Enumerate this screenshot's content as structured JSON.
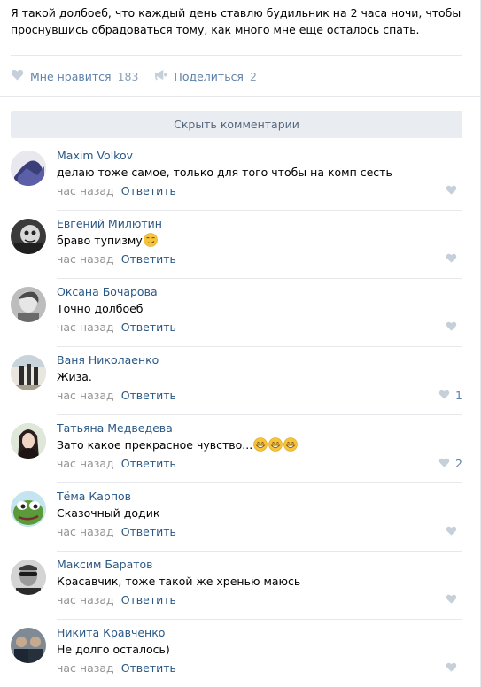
{
  "post": {
    "text": "Я такой долбоеб, что каждый день ставлю будильник на 2 часа ночи, чтобы проснувшись обрадоваться тому, как много мне еще осталось спать."
  },
  "actions": {
    "like_label": "Мне нравится",
    "like_count": "183",
    "share_label": "Поделиться",
    "share_count": "2"
  },
  "hide_comments_label": "Скрыть комментарии",
  "comments": [
    {
      "name": "Maxim Volkov",
      "text": "делаю тоже самое, только для того чтобы на комп сесть",
      "time": "час назад",
      "reply": "Ответить",
      "likes": "",
      "emoji": ""
    },
    {
      "name": "Евгений Милютин",
      "text": "браво тупизму",
      "time": "час назад",
      "reply": "Ответить",
      "likes": "",
      "emoji": "smirk-emoji"
    },
    {
      "name": "Оксана Бочарова",
      "text": "Точно долбоеб",
      "time": "час назад",
      "reply": "Ответить",
      "likes": "",
      "emoji": ""
    },
    {
      "name": "Ваня Николаенко",
      "text": "Жиза.",
      "time": "час назад",
      "reply": "Ответить",
      "likes": "1",
      "emoji": ""
    },
    {
      "name": "Татьяна Медведева",
      "text": "Зато какое прекрасное чувство...",
      "time": "час назад",
      "reply": "Ответить",
      "likes": "2",
      "emoji": "grin-emoji x3"
    },
    {
      "name": "Тёма Карпов",
      "text": "Сказочный додик",
      "time": "час назад",
      "reply": "Ответить",
      "likes": "",
      "emoji": ""
    },
    {
      "name": "Максим Баратов",
      "text": "Красавчик, тоже такой же хренью маюсь",
      "time": "час назад",
      "reply": "Ответить",
      "likes": "",
      "emoji": ""
    },
    {
      "name": "Никита Кравченко",
      "text": "Не долго осталось)",
      "time": "час назад",
      "reply": "Ответить",
      "likes": "",
      "emoji": ""
    }
  ],
  "colors": {
    "link": "#2a5885",
    "action": "#5e81a8",
    "muted": "#939393",
    "button_bg": "#e9edf2",
    "divider": "#e7e8ec"
  }
}
